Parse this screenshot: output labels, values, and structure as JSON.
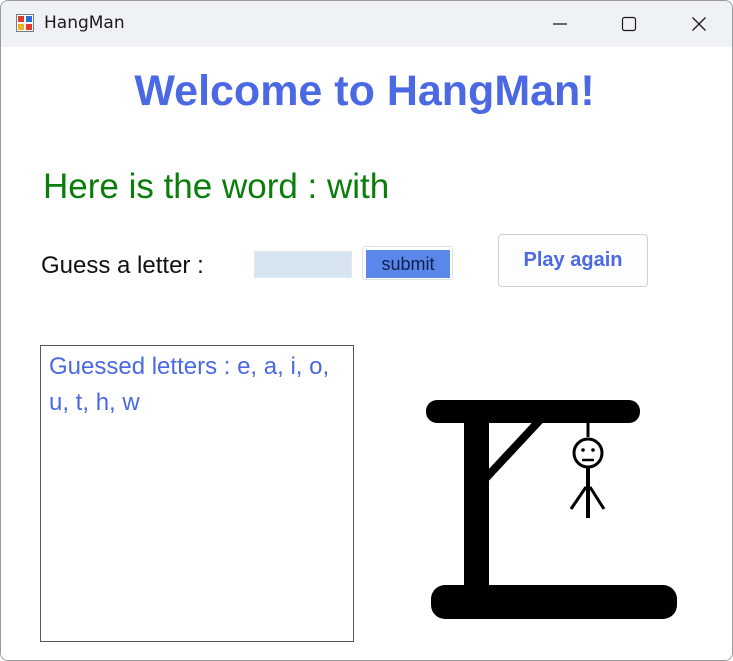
{
  "window": {
    "title": "HangMan",
    "icon": "winforms-app-icon",
    "controls": [
      "minimize-icon",
      "maximize-icon",
      "close-icon"
    ]
  },
  "welcome": "Welcome to HangMan!",
  "word_line": "Here is the word : with",
  "guess": {
    "label": "Guess a letter :",
    "input_value": "",
    "submit_label": "submit"
  },
  "play_again_label": "Play again",
  "guessed_letters_text": "Guessed letters : e, a, i, o, u, t, h, w",
  "colors": {
    "accent_blue": "#4b69e3",
    "word_green": "#0a7d0a",
    "submit_blue": "#5b86ea",
    "input_bg": "#d6e4f2"
  },
  "gallows_face": "sad-face"
}
